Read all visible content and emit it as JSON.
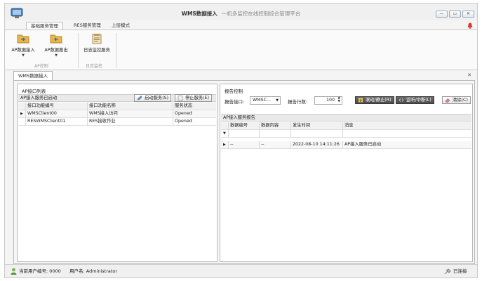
{
  "window": {
    "title": "WMS数据接入",
    "subtitle": "一机多监控在线控制综合管理平台",
    "min_label": "—",
    "max_label": "▭",
    "close_label": "✕"
  },
  "menu": {
    "tabs": [
      {
        "label": "基础服务管理",
        "active": true
      },
      {
        "label": "RES服务管理",
        "active": false
      },
      {
        "label": "上层模式",
        "active": false
      }
    ]
  },
  "ribbon": {
    "buttons": [
      {
        "label": "AP数据接入",
        "icon": "folder-import-icon"
      },
      {
        "label": "AP数据推出",
        "icon": "folder-export-icon"
      },
      {
        "label": "日志监控服务",
        "icon": "log-monitor-icon"
      }
    ],
    "groups": [
      "AP控制",
      "日志监控"
    ]
  },
  "doc_tab": {
    "label": "WMS数据接入",
    "close": "✕"
  },
  "left_panel": {
    "title": "AP接口列表",
    "status": "AP接入服务已启动",
    "start_btn": "启动服务(S)",
    "stop_btn": "停止服务(E)",
    "columns": [
      "接口功能编号",
      "接口功能名称",
      "服务状态"
    ],
    "rows": [
      {
        "indicator": "▶",
        "id": "WMSClient00",
        "name": "WMS接入访问",
        "state": "Opened"
      },
      {
        "indicator": "",
        "id": "RESWMSClient01",
        "name": "RES接收作业",
        "state": "Opened"
      }
    ]
  },
  "right_panel": {
    "title": "报告控制",
    "report_label": "报告接口:",
    "report_value": "WMSC...",
    "rows_label": "报告行数:",
    "rows_value": "100",
    "scroll_btn": "滚动/静止(R)",
    "monitor_btn": "监听/中断(L)",
    "clear_btn": "清除(C)",
    "report_title": "AP接入服务报告",
    "columns": [
      "数据编号",
      "数据内容",
      "发生时间",
      "消息"
    ],
    "filter_indicator": "▼",
    "rows": [
      {
        "indicator": "▶",
        "num": "--",
        "content": "--",
        "time": "2022-08-10 14:11:26",
        "msg": "AP接入服务已启动"
      }
    ]
  },
  "statusbar": {
    "user_id": "当前用户编号: 0000",
    "user_name": "用户名: Administrator",
    "connection": "已连接"
  }
}
